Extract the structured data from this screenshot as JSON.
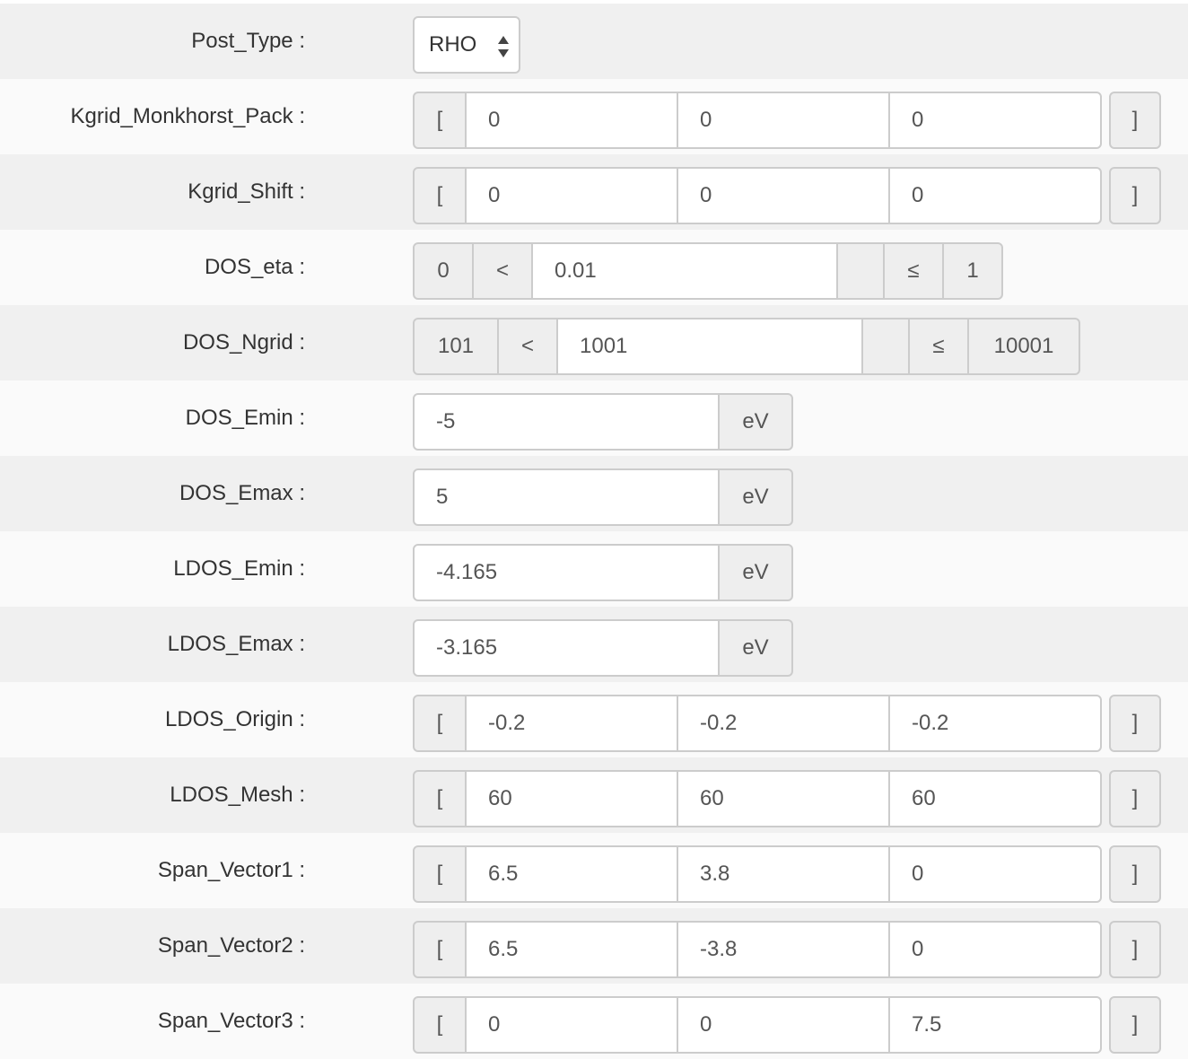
{
  "rows": [
    {
      "label": "Post_Type :",
      "value": "RHO"
    },
    {
      "label": "Kgrid_Monkhorst_Pack :",
      "open": "[",
      "values": [
        "0",
        "0",
        "0"
      ],
      "close": "]"
    },
    {
      "label": "Kgrid_Shift :",
      "open": "[",
      "values": [
        "0",
        "0",
        "0"
      ],
      "close": "]"
    },
    {
      "label": "DOS_eta :",
      "min": "0",
      "lt": "<",
      "value": "0.01",
      "le": "≤",
      "max": "1"
    },
    {
      "label": "DOS_Ngrid :",
      "min": "101",
      "lt": "<",
      "value": "1001",
      "le": "≤",
      "max": "10001"
    },
    {
      "label": "DOS_Emin :",
      "value": "-5",
      "unit": "eV"
    },
    {
      "label": "DOS_Emax :",
      "value": "5",
      "unit": "eV"
    },
    {
      "label": "LDOS_Emin :",
      "value": "-4.165",
      "unit": "eV"
    },
    {
      "label": "LDOS_Emax :",
      "value": "-3.165",
      "unit": "eV"
    },
    {
      "label": "LDOS_Origin :",
      "open": "[",
      "values": [
        "-0.2",
        "-0.2",
        "-0.2"
      ],
      "close": "]"
    },
    {
      "label": "LDOS_Mesh :",
      "open": "[",
      "values": [
        "60",
        "60",
        "60"
      ],
      "close": "]"
    },
    {
      "label": "Span_Vector1 :",
      "open": "[",
      "values": [
        "6.5",
        "3.8",
        "0"
      ],
      "close": "]"
    },
    {
      "label": "Span_Vector2 :",
      "open": "[",
      "values": [
        "6.5",
        "-3.8",
        "0"
      ],
      "close": "]"
    },
    {
      "label": "Span_Vector3 :",
      "open": "[",
      "values": [
        "0",
        "0",
        "7.5"
      ],
      "close": "]"
    }
  ],
  "icons": {
    "select_arrows": "up-down-arrows-icon"
  },
  "colors": {
    "row_shade": "#f0f0f0",
    "addon_bg": "#eeeeee",
    "border": "#cccccc",
    "text": "#333333"
  }
}
